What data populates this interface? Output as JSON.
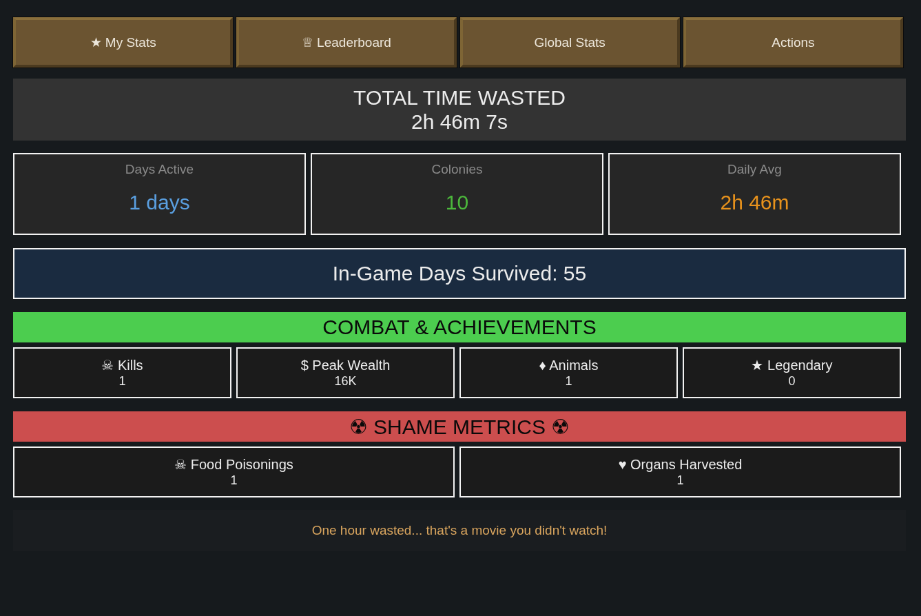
{
  "nav_buttons": [
    {
      "label": "★ My Stats"
    },
    {
      "label": "♕ Leaderboard"
    },
    {
      "label": "Global Stats"
    },
    {
      "label": "Actions"
    }
  ],
  "total_time": {
    "title": "TOTAL TIME WASTED",
    "value": "2h 46m 7s"
  },
  "summary_cards": [
    {
      "label": "Days Active",
      "value": "1 days",
      "color": "#5a9fe0"
    },
    {
      "label": "Colonies",
      "value": "10",
      "color": "#4cb83c"
    },
    {
      "label": "Daily Avg",
      "value": "2h 46m",
      "color": "#e8921c"
    }
  ],
  "days_survived": {
    "text": "In-Game Days Survived: 55"
  },
  "sections": [
    {
      "title": "COMBAT & ACHIEVEMENTS",
      "color": "#4ccd4f",
      "stats": [
        {
          "label": "☠ Kills",
          "value": "1"
        },
        {
          "label": "$ Peak Wealth",
          "value": "16K"
        },
        {
          "label": "♦ Animals",
          "value": "1"
        },
        {
          "label": "★ Legendary",
          "value": "0"
        }
      ]
    },
    {
      "title": "☢ SHAME METRICS ☢",
      "color": "#cc4e4e",
      "stats": [
        {
          "label": "☠ Food Poisonings",
          "value": "1"
        },
        {
          "label": "♥ Organs Harvested",
          "value": "1"
        }
      ]
    }
  ],
  "message": "One hour wasted... that's a movie you didn't watch!"
}
